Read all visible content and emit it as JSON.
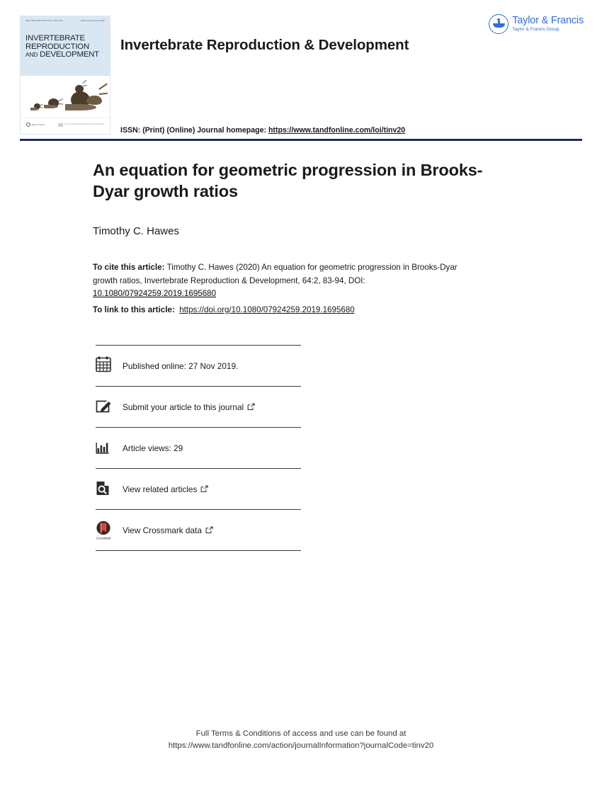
{
  "header": {
    "journal_name": "Invertebrate Reproduction & Development",
    "issn_prefix": "ISSN: (Print) (Online) Journal homepage:",
    "issn_url": "https://www.tandfonline.com/loi/tinv20",
    "publisher_logo": {
      "name": "taylor-and-francis-logo",
      "main": "Taylor & Francis",
      "sub": "Taylor & Francis Group",
      "color": "#2f6fdd"
    },
    "cover": {
      "title_line1": "INVERTEBRATE",
      "title_line2": "REPRODUCTION",
      "title_line3_small": "AND",
      "title_line3": "DEVELOPMENT",
      "issn_micro": "ISSN: 0792-4259\nISSN Online: 2157-0272",
      "volume_micro": "Volume 64  Issue 2  June 2020",
      "footer_left": "Taylor & Francis",
      "footer_left_sub": "Taylor & Francis Group",
      "footer_right": "Society for Invertebrate\nReproduction & Development",
      "bg_color": "#d9e7f2"
    },
    "rule_color": "#1f2a63"
  },
  "article": {
    "title": "An equation for geometric progression in Brooks-Dyar growth ratios",
    "author": "Timothy C. Hawes",
    "cite_label": "To cite this article:",
    "cite_text": " Timothy C. Hawes (2020) An equation for geometric progression in Brooks-Dyar growth ratios, Invertebrate Reproduction & Development, 64:2, 83-94, DOI: ",
    "cite_doi": "10.1080/07924259.2019.1695680",
    "link_label": "To link to this article:",
    "link_url": "https://doi.org/10.1080/07924259.2019.1695680"
  },
  "actions": [
    {
      "id": "published-online",
      "icon": "calendar-icon",
      "label": "Published online: 27 Nov 2019.",
      "external": false
    },
    {
      "id": "submit-article",
      "icon": "pencil-square-icon",
      "label": "Submit your article to this journal",
      "external": true
    },
    {
      "id": "article-views",
      "icon": "bar-chart-icon",
      "label": "Article views: 29",
      "external": false
    },
    {
      "id": "view-related-articles",
      "icon": "document-search-icon",
      "label": "View related articles",
      "external": true
    },
    {
      "id": "view-crossmark-data",
      "icon": "crossmark-icon",
      "label": "View Crossmark data",
      "external": true,
      "icon_caption": "CrossMark"
    }
  ],
  "footer": {
    "line1": "Full Terms & Conditions of access and use can be found at",
    "line2": "https://www.tandfonline.com/action/journalInformation?journalCode=tinv20"
  }
}
